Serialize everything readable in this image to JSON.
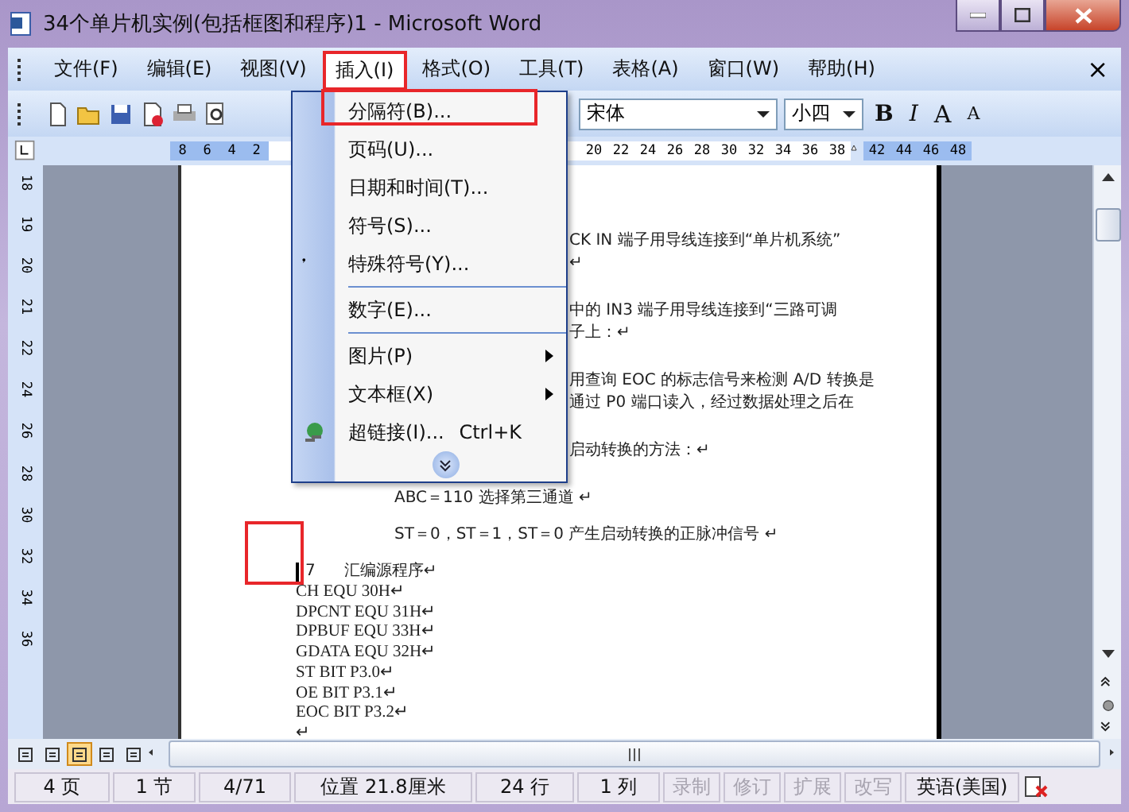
{
  "window": {
    "title": "34个单片机实例(包括框图和程序)1 - Microsoft Word"
  },
  "menu_bar": {
    "items": [
      {
        "label": "文件(F)",
        "selected": false,
        "annotated": false
      },
      {
        "label": "编辑(E)",
        "selected": false,
        "annotated": false
      },
      {
        "label": "视图(V)",
        "selected": false,
        "annotated": false
      },
      {
        "label": "插入(I)",
        "selected": true,
        "annotated": true
      },
      {
        "label": "格式(O)",
        "selected": false,
        "annotated": false
      },
      {
        "label": "工具(T)",
        "selected": false,
        "annotated": false
      },
      {
        "label": "表格(A)",
        "selected": false,
        "annotated": false
      },
      {
        "label": "窗口(W)",
        "selected": false,
        "annotated": false
      },
      {
        "label": "帮助(H)",
        "selected": false,
        "annotated": false
      }
    ],
    "close": "×"
  },
  "toolbar": {
    "font": "宋体",
    "size": "小四",
    "format_buttons": [
      {
        "label": "B",
        "kind": "bold"
      },
      {
        "label": "I",
        "kind": "italic"
      },
      {
        "label": "A",
        "kind": "grow"
      },
      {
        "label": "A",
        "kind": "shrink"
      }
    ]
  },
  "ruler": {
    "left_ticks": [
      "8",
      "6",
      "4",
      "2"
    ],
    "right_ticks": [
      "20",
      "22",
      "24",
      "26",
      "28",
      "30",
      "32",
      "34",
      "36",
      "38"
    ],
    "far_ticks": [
      "42",
      "44",
      "46",
      "48"
    ]
  },
  "vertical_ruler": [
    "18",
    "19",
    "20",
    "21",
    "22",
    "24",
    "26",
    "28",
    "30",
    "32",
    "34",
    "36"
  ],
  "insert_menu": {
    "entries": [
      {
        "kind": "item",
        "label": "分隔符(B)...",
        "annotated": true,
        "has_submenu": false,
        "has_icon": false
      },
      {
        "kind": "item",
        "label": "页码(U)...",
        "annotated": false,
        "has_submenu": false,
        "has_icon": false
      },
      {
        "kind": "item",
        "label": "日期和时间(T)...",
        "annotated": false,
        "has_submenu": false,
        "has_icon": false
      },
      {
        "kind": "item",
        "label": "符号(S)...",
        "annotated": false,
        "has_submenu": false,
        "has_icon": false
      },
      {
        "kind": "item",
        "label": "特殊符号(Y)...",
        "annotated": false,
        "has_submenu": false,
        "has_icon": true
      },
      {
        "kind": "separator"
      },
      {
        "kind": "item",
        "label": "数字(E)...",
        "annotated": false,
        "has_submenu": false,
        "has_icon": false
      },
      {
        "kind": "separator"
      },
      {
        "kind": "item",
        "label": "图片(P)",
        "annotated": false,
        "has_submenu": true,
        "has_icon": false
      },
      {
        "kind": "item",
        "label": "文本框(X)",
        "annotated": false,
        "has_submenu": true,
        "has_icon": false
      },
      {
        "kind": "item",
        "label": "超链接(I)...",
        "shortcut": "Ctrl+K",
        "annotated": false,
        "has_submenu": false,
        "has_icon": true
      },
      {
        "kind": "expand"
      }
    ]
  },
  "document": {
    "paragraphs": [
      {
        "kind": "fragment",
        "lines": [
          "CK IN 端子用导线连接到“单片机系统”",
          "↵"
        ]
      },
      {
        "kind": "fragment",
        "lines": [
          "中的 IN3 端子用导线连接到“三路可调",
          "子上：↵"
        ]
      },
      {
        "kind": "fragment",
        "lines": [
          "用查询 EOC 的标志信号来检测 A/D 转换是",
          "通过 P0 端口读入，经过数据处理之后在"
        ]
      },
      {
        "kind": "fragment",
        "lines": [
          "启动转换的方法：↵"
        ]
      },
      {
        "kind": "indented",
        "lines": [
          "ABC＝110 选择第三通道 ↵"
        ]
      },
      {
        "kind": "indented",
        "lines": [
          "ST＝0，ST＝1，ST＝0 产生启动转换的正脉冲信号 ↵"
        ]
      },
      {
        "kind": "heading",
        "number": "7",
        "lines": [
          "汇编源程序↵"
        ],
        "annotated": true
      },
      {
        "kind": "code",
        "lines": [
          "CH EQU 30H↵",
          "DPCNT EQU 31H↵",
          "DPBUF EQU 33H↵",
          "GDATA EQU 32H↵",
          "ST BIT P3.0↵",
          "OE BIT P3.1↵",
          "EOC BIT P3.2↵",
          "↵"
        ]
      }
    ]
  },
  "view_buttons": [
    {
      "selected": false
    },
    {
      "selected": false
    },
    {
      "selected": true
    },
    {
      "selected": false
    },
    {
      "selected": false
    }
  ],
  "status_bar": {
    "fields": [
      {
        "text": "4 页",
        "disabled": false
      },
      {
        "text": "1 节",
        "disabled": false
      },
      {
        "text": "4/71",
        "disabled": false
      },
      {
        "text": "位置 21.8厘米",
        "disabled": false
      },
      {
        "text": "24 行",
        "disabled": false
      },
      {
        "text": "1 列",
        "disabled": false
      },
      {
        "text": "录制",
        "disabled": true
      },
      {
        "text": "修订",
        "disabled": true
      },
      {
        "text": "扩展",
        "disabled": true
      },
      {
        "text": "改写",
        "disabled": true
      },
      {
        "text": "英语(美国)",
        "disabled": false
      }
    ]
  }
}
